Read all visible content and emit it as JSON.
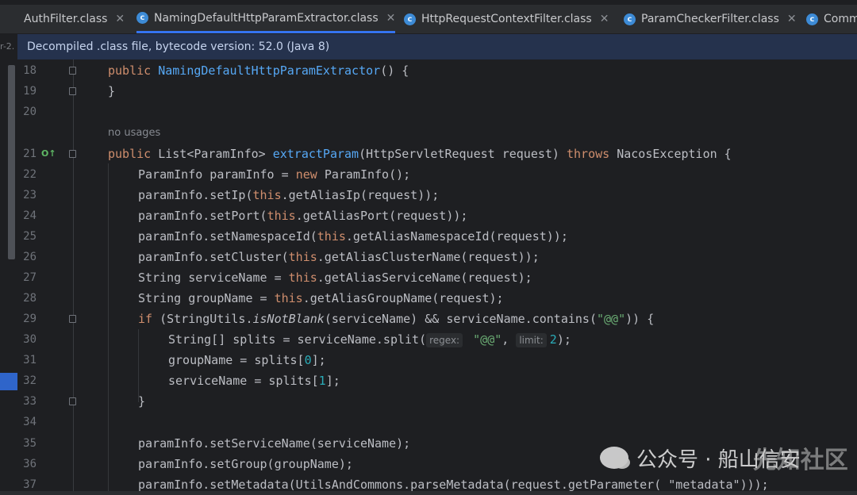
{
  "tabs": [
    {
      "label": "AuthFilter.class",
      "icon": "class-icon",
      "closable": true,
      "active": false
    },
    {
      "label": "NamingDefaultHttpParamExtractor.class",
      "icon": "class-icon",
      "closable": true,
      "active": true
    },
    {
      "label": "HttpRequestContextFilter.class",
      "icon": "class-icon",
      "closable": true,
      "active": false
    },
    {
      "label": "ParamCheckerFilter.class",
      "icon": "class-icon",
      "closable": true,
      "active": false
    },
    {
      "label": "Comm",
      "icon": "class-icon",
      "closable": false,
      "active": false
    }
  ],
  "left_stub": "r-2.",
  "banner": "Decompiled .class file, bytecode version: 52.0 (Java 8)",
  "usage_hint": "no usages",
  "line_numbers": [
    "18",
    "19",
    "20",
    "21",
    "22",
    "23",
    "24",
    "25",
    "26",
    "27",
    "28",
    "29",
    "30",
    "31",
    "32",
    "33",
    "34",
    "35",
    "36",
    "37"
  ],
  "code": {
    "l18": {
      "kw": "public ",
      "name": "NamingDefaultHttpParamExtractor",
      "rest": "() {"
    },
    "l19": "}",
    "l21": {
      "kw1": "public ",
      "type": "List<ParamInfo> ",
      "name": "extractParam",
      "args": "(HttpServletRequest request) ",
      "kw2": "throws ",
      "rest": "NacosException {"
    },
    "l22": {
      "a": "ParamInfo paramInfo = ",
      "kw": "new ",
      "b": "ParamInfo();"
    },
    "l23": {
      "a": "paramInfo.setIp(",
      "kw": "this",
      "b": ".getAliasIp(request));"
    },
    "l24": {
      "a": "paramInfo.setPort(",
      "kw": "this",
      "b": ".getAliasPort(request));"
    },
    "l25": {
      "a": "paramInfo.setNamespaceId(",
      "kw": "this",
      "b": ".getAliasNamespaceId(request));"
    },
    "l26": {
      "a": "paramInfo.setCluster(",
      "kw": "this",
      "b": ".getAliasClusterName(request));"
    },
    "l27": {
      "a": "String serviceName = ",
      "kw": "this",
      "b": ".getAliasServiceName(request);"
    },
    "l28": {
      "a": "String groupName = ",
      "kw": "this",
      "b": ".getAliasGroupName(request);"
    },
    "l29": {
      "kw": "if ",
      "a": "(StringUtils.",
      "it": "isNotBlank",
      "b": "(serviceName) && serviceName.contains(",
      "str": "\"@@\"",
      "c": ")) {"
    },
    "l30": {
      "a": "String[] splits = serviceName.split(",
      "hint1": "regex:",
      "str": " \"@@\"",
      "comma": ",",
      "hint2": "limit:",
      "num": "2",
      "c": ");"
    },
    "l31": {
      "a": "groupName = splits[",
      "num": "0",
      "b": "];"
    },
    "l32": {
      "a": "serviceName = splits[",
      "num": "1",
      "b": "];"
    },
    "l33": "}",
    "l35": "paramInfo.setServiceName(serviceName);",
    "l36": "paramInfo.setGroup(groupName);",
    "l37": "paramInfo.setMetadata(UtilsAndCommons.parseMetadata(request.getParameter( \"metadata\")));"
  },
  "watermark": {
    "text": "公众号 · 船山信安",
    "overlay": "先知社区"
  },
  "colors": {
    "keyword": "#cf8e6d",
    "method": "#56a8f5",
    "number": "#2aacb8",
    "string": "#6aab73",
    "accent": "#3574f0"
  }
}
